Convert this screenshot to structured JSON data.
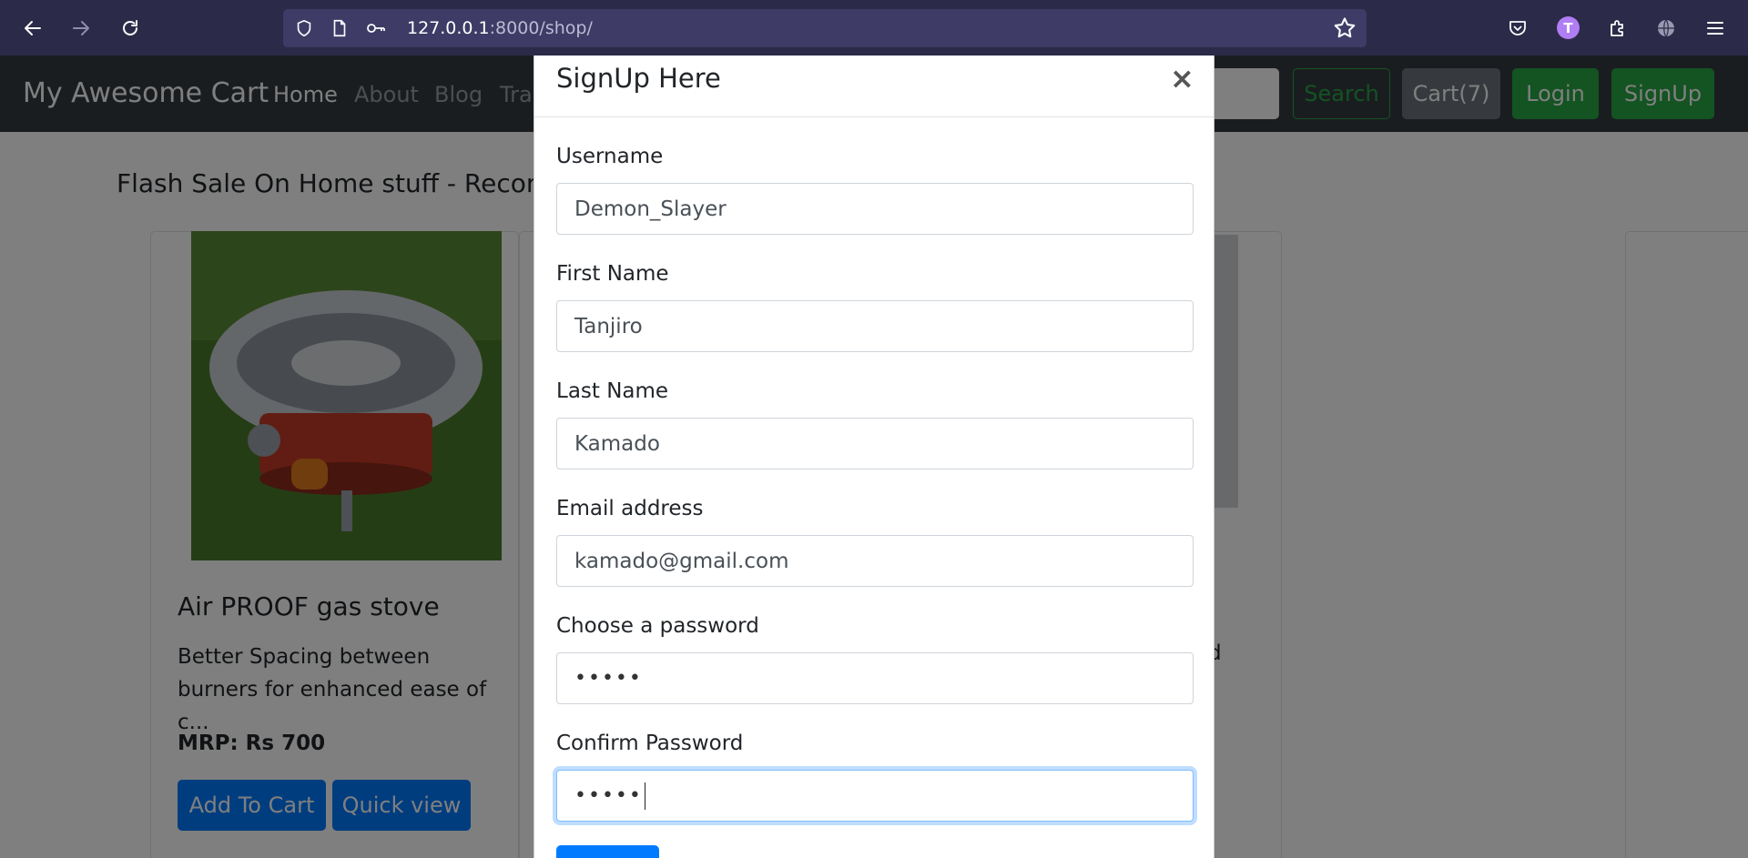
{
  "browser": {
    "url_host": "127.0.0.1",
    "url_path": ":8000/shop/",
    "profile_initial": "T"
  },
  "site": {
    "brand": "My Awesome Cart",
    "nav": [
      "Home",
      "About",
      "Blog",
      "Trac"
    ],
    "search_label": "Search",
    "cart_label": "Cart(7)",
    "login_label": "Login",
    "signup_label": "SignUp",
    "section_title": "Flash Sale On Home stuff - Recomm",
    "card": {
      "title": "Air PROOF gas stove",
      "text": "Better Spacing between burners for enhanced ease of c...",
      "price": "MRP: Rs 700",
      "add_label": "Add To Cart",
      "quick_label": "Quick view"
    },
    "card2_text_fragment": "d"
  },
  "modal": {
    "title": "SignUp Here",
    "close": "×",
    "fields": {
      "username": {
        "label": "Username",
        "value": "Demon_Slayer"
      },
      "first_name": {
        "label": "First Name",
        "value": "Tanjiro"
      },
      "last_name": {
        "label": "Last Name",
        "value": "Kamado"
      },
      "email": {
        "label": "Email address",
        "value": "kamado@gmail.com"
      },
      "password": {
        "label": "Choose a password",
        "value": "•••••"
      },
      "confirm": {
        "label": "Confirm Password",
        "value": "•••••"
      }
    }
  },
  "colors": {
    "chrome": "#2b2a48",
    "navbar": "#343a40",
    "primary": "#007bff",
    "success": "#28a745",
    "secondary": "#6c757d"
  },
  "icons": [
    "back-arrow-icon",
    "forward-arrow-icon",
    "reload-icon",
    "shield-icon",
    "page-icon",
    "key-icon",
    "star-icon",
    "pocket-icon",
    "extensions-icon",
    "globe-icon",
    "menu-icon"
  ]
}
